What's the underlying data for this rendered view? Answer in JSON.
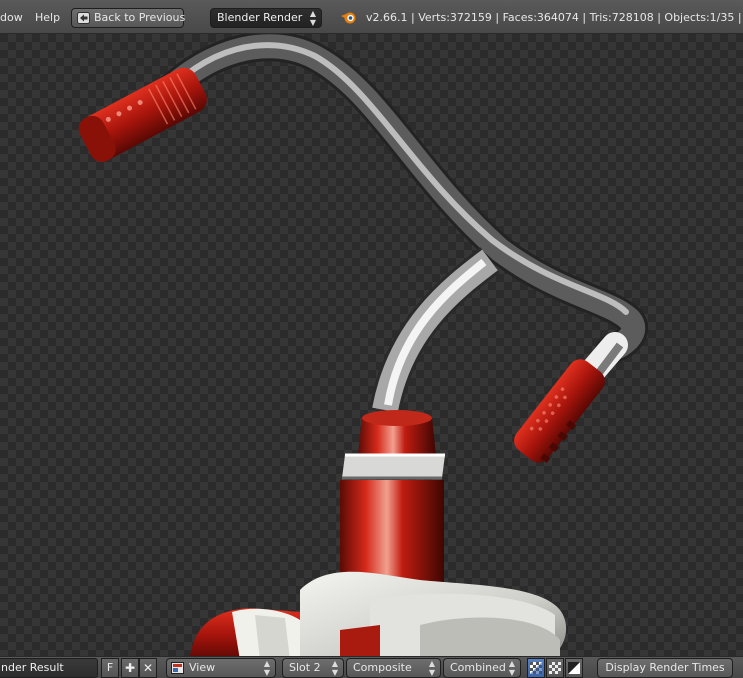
{
  "topbar": {
    "menu_window": "dow",
    "menu_help": "Help",
    "back_button": "Back to Previous",
    "engine": "Blender Render",
    "info": "v2.66.1 | Verts:372159 | Faces:364074 | Tris:728108 | Objects:1/35 | Lam"
  },
  "bottombar": {
    "image_name": "nder Result",
    "fake_user": "F",
    "view_menu": "View",
    "slot": "Slot 2",
    "layer": "Composite",
    "pass": "Combined",
    "display_times": "Display Render Times"
  },
  "icons": {
    "back": "back-arrow-icon",
    "engine": "blender-logo-icon",
    "image": "image-icon",
    "new": "plus-icon",
    "close": "x-icon",
    "view_editor": "editor-type-icon",
    "color_alpha": "color-alpha-icon",
    "alpha_checker": "checker-icon",
    "z_buffer": "z-buffer-icon"
  },
  "colors": {
    "red_grip": "#b01a10",
    "chrome": "#c8c8c8",
    "dark_metal": "#4a4a4a",
    "background_check": "#2b2b2b"
  }
}
